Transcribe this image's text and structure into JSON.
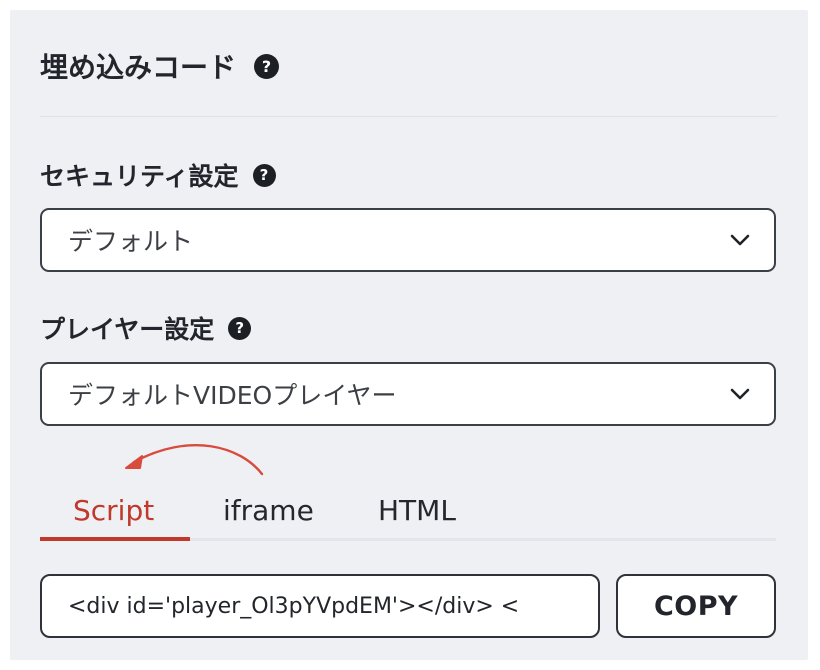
{
  "header": {
    "title": "埋め込みコード",
    "help": "?"
  },
  "security": {
    "label": "セキュリティ設定",
    "help": "?",
    "selected": "デフォルト"
  },
  "player": {
    "label": "プレイヤー設定",
    "help": "?",
    "selected": "デフォルトVIDEOプレイヤー"
  },
  "tabs": [
    {
      "label": "Script",
      "active": true
    },
    {
      "label": "iframe",
      "active": false
    },
    {
      "label": "HTML",
      "active": false
    }
  ],
  "embed": {
    "code": "<div id='player_Ol3pYVpdEM'></div>  <",
    "copy_label": "COPY"
  },
  "colors": {
    "accent": "#c0392b",
    "panel_bg": "#eef0f4",
    "help_icon_bg": "#1c1f24"
  }
}
